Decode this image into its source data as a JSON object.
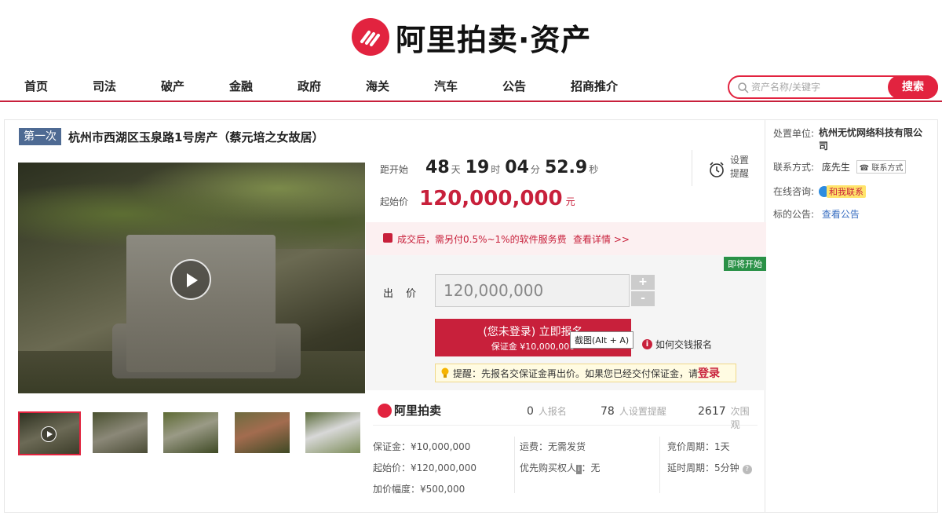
{
  "brand": {
    "logo_text": "阿里拍卖·资产",
    "brand_color": "#e2233f"
  },
  "nav": {
    "items": [
      "首页",
      "司法",
      "破产",
      "金融",
      "政府",
      "海关",
      "汽车",
      "公告",
      "招商推介"
    ],
    "search_placeholder": "资产名称/关键字",
    "search_button": "搜索"
  },
  "listing": {
    "round_badge": "第一次",
    "title": "杭州市西湖区玉泉路1号房产（蔡元培之女故居）",
    "countdown": {
      "label": "距开始",
      "days": "48",
      "days_unit": "天",
      "hours": "19",
      "hours_unit": "时",
      "minutes": "04",
      "minutes_unit": "分",
      "seconds": "52.9",
      "seconds_unit": "秒"
    },
    "remind": {
      "label": "设置提醒",
      "icon": "alarm-clock-icon"
    },
    "start_price_label": "起始价",
    "start_price": "120,000,000",
    "price_unit": "元",
    "fee_notice": "成交后，需另付0.5%~1%的软件服务费",
    "fee_link": "查看详情 >>",
    "status_tag": "即将开始",
    "bid_label": "出 价",
    "bid_value": "120,000,000",
    "plus": "+",
    "minus": "-",
    "signup_line1": "(您未登录) 立即报名",
    "signup_line2": "保证金 ¥10,000,000",
    "tooltip": "截图(Alt + A)",
    "how_to": "如何交钱报名",
    "tip_text": "提醒：先报名交保证金再出价。如果您已经交付保证金，请",
    "tip_login": "登录"
  },
  "stats": {
    "logo_text": "阿里拍卖",
    "registered": "0",
    "registered_label": "人报名",
    "reminders": "78",
    "reminders_label": "人设置提醒",
    "views": "2617",
    "views_label": "次围观"
  },
  "details": {
    "deposit": "保证金：¥10,000,000",
    "start_price": "起始价：¥120,000,000",
    "increment": "加价幅度：¥500,000",
    "shipping": "运费：无需发货",
    "priority_prefix": "优先购买权人",
    "priority_tag": "i",
    "priority_value": "：无",
    "cycle": "竞价周期：1天",
    "delay": "延时周期：5分钟",
    "help": "?"
  },
  "side": {
    "org_label": "处置单位:",
    "org_value": "杭州无忧网络科技有限公司",
    "contact_label": "联系方式:",
    "contact_name": "庞先生",
    "contact_btn": "联系方式",
    "consult_label": "在线咨询:",
    "consult_btn": "和我联系",
    "notice_label": "标的公告:",
    "notice_link": "查看公告"
  }
}
